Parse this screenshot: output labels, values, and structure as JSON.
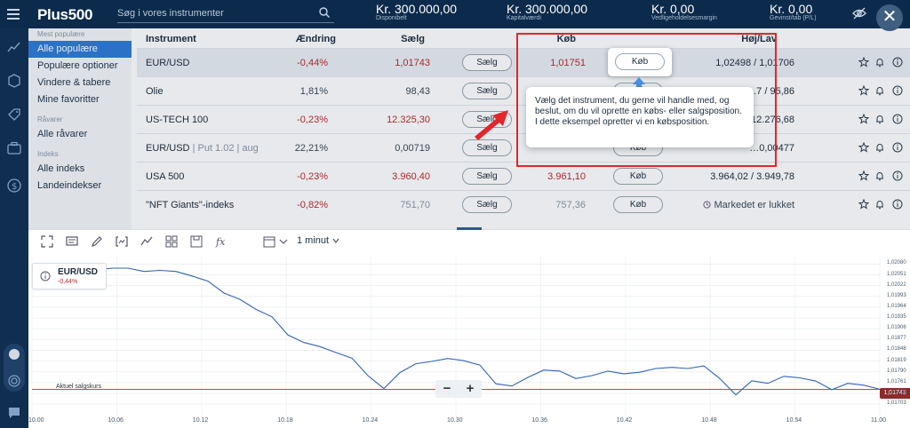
{
  "header": {
    "logo": "Plus500",
    "search_placeholder": "Søg i vores instrumenter",
    "stats": [
      {
        "value": "Kr. 300.000,00",
        "label": "Disponibelt"
      },
      {
        "value": "Kr. 300.000,00",
        "label": "Kapitalværdi"
      },
      {
        "value": "Kr. 0,00",
        "label": "Vedligeholdelsesmargin"
      },
      {
        "value": "Kr. 0,00",
        "label": "Gevinst/tab (P/L)"
      }
    ],
    "close_label": "✕"
  },
  "categories": {
    "groups": [
      {
        "heading": "Mest populære",
        "items": [
          "Alle populære",
          "Populære optioner",
          "Vindere & tabere",
          "Mine favoritter"
        ]
      },
      {
        "heading": "Råvarer",
        "items": [
          "Alle råvarer"
        ]
      },
      {
        "heading": "Indeks",
        "items": [
          "Alle indeks",
          "Landeindekser"
        ]
      }
    ],
    "active": "Alle populære"
  },
  "table": {
    "headers": {
      "instrument": "Instrument",
      "change": "Ændring",
      "sell": "Sælg",
      "buy": "Køb",
      "highlow": "Høj/Lav"
    },
    "sell_button": "Sælg",
    "buy_button": "Køb",
    "rows": [
      {
        "name": "EUR/USD",
        "sub": "",
        "change": "-0,44%",
        "sell": "1,01743",
        "buy": "1,01751",
        "highlow": "1,02498 / 1,01706"
      },
      {
        "name": "Olie",
        "sub": "",
        "change": "1,81%",
        "sell": "98,43",
        "buy": "",
        "highlow": "…7 / 95,86"
      },
      {
        "name": "US-TECH 100",
        "sub": "",
        "change": "-0,23%",
        "sell": "12.325,30",
        "buy": "",
        "highlow": "…2 / 12.276,68"
      },
      {
        "name": "EUR/USD",
        "sub": " | Put 1.02 | aug",
        "change": "22,21%",
        "sell": "0,00719",
        "buy": "",
        "highlow": "…0,00477"
      },
      {
        "name": "USA 500",
        "sub": "",
        "change": "-0,23%",
        "sell": "3.960,40",
        "buy": "3.961,10",
        "highlow": "3.964,02 / 3.949,78"
      },
      {
        "name": "\"NFT Giants\"-indeks",
        "sub": "",
        "change": "-0,82%",
        "sell": "751,70",
        "buy": "757,36",
        "highlow": "Markedet er lukket"
      }
    ]
  },
  "tutorial": {
    "text": "Vælg det instrument, du gerne vil handle med, og beslut, om du vil oprette en købs- eller salgsposition. I dette eksempel opretter vi en købsposition."
  },
  "chart_toolbar": {
    "interval": "1 minut"
  },
  "chart_data": {
    "type": "line",
    "title": "EUR/USD",
    "change": "-0,44%",
    "current_price_label": "Aktuel salgskurs",
    "current_price": 1.01743,
    "current_price_text": "1,01743",
    "x": [
      "10.00",
      "10.06",
      "10.12",
      "10.18",
      "10.24",
      "10.30",
      "10.36",
      "10.42",
      "10.48",
      "10.54",
      "11.00"
    ],
    "ylim": [
      1.0167,
      1.021
    ],
    "y_ticks": [
      "1,02080",
      "1,02051",
      "1,02022",
      "1,01993",
      "1,01964",
      "1,01935",
      "1,01906",
      "1,01877",
      "1,01848",
      "1,01819",
      "1,01790",
      "1,01761",
      "1,01732",
      "1,01703"
    ],
    "series": [
      {
        "values": [
          1.02058,
          1.0205,
          1.02066,
          1.02057,
          1.02064,
          1.02069,
          1.02069,
          1.0206,
          1.02063,
          1.0206,
          1.02048,
          1.02034,
          1.02002,
          1.01985,
          1.01958,
          1.01938,
          1.01889,
          1.01869,
          1.01858,
          1.01842,
          1.01827,
          1.0178,
          1.01745,
          1.01788,
          1.01812,
          1.01818,
          1.01826,
          1.0182,
          1.01808,
          1.01758,
          1.01752,
          1.01775,
          1.01795,
          1.01792,
          1.01772,
          1.0178,
          1.01792,
          1.01785,
          1.01789,
          1.01799,
          1.01802,
          1.01799,
          1.01806,
          1.01772,
          1.01728,
          1.01766,
          1.01759,
          1.01778,
          1.01774,
          1.01765,
          1.01742,
          1.01759,
          1.01754,
          1.01743
        ]
      }
    ]
  }
}
